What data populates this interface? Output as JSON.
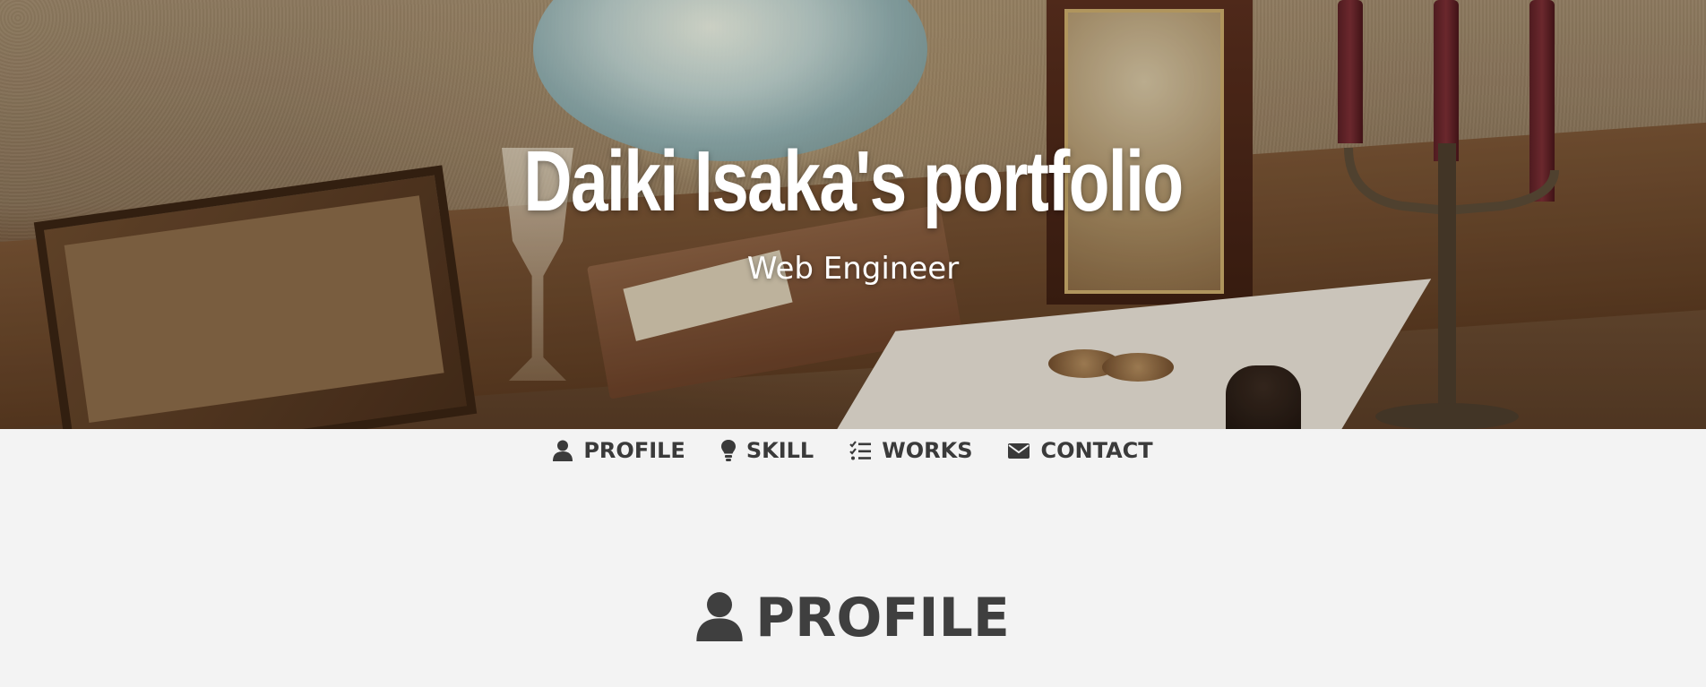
{
  "hero": {
    "title": "Daiki Isaka's portfolio",
    "subtitle": "Web Engineer"
  },
  "nav": {
    "items": [
      {
        "label": "PROFILE",
        "icon": "user-icon"
      },
      {
        "label": "SKILL",
        "icon": "lightbulb-icon"
      },
      {
        "label": "WORKS",
        "icon": "checklist-icon"
      },
      {
        "label": "CONTACT",
        "icon": "envelope-icon"
      }
    ]
  },
  "section": {
    "title": "PROFILE",
    "icon": "user-icon"
  },
  "colors": {
    "background": "#f3f3f3",
    "text": "#3a3a3a",
    "hero_text": "#ffffff"
  }
}
